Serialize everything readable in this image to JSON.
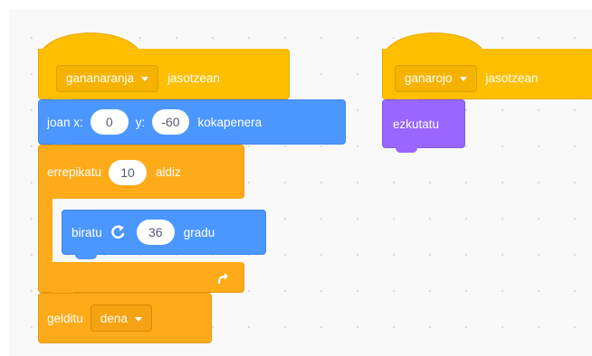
{
  "scripts": [
    {
      "hat": {
        "message": "gananaranja",
        "suffix": "jasotzean"
      },
      "goto": {
        "prefix": "joan x:",
        "x": "0",
        "y_label": "y:",
        "y": "-60",
        "suffix": "kokapenera"
      },
      "repeat": {
        "prefix": "errepikatu",
        "times": "10",
        "suffix": "aldiz"
      },
      "turn": {
        "prefix": "biratu",
        "degrees": "36",
        "suffix": "gradu"
      },
      "stop": {
        "prefix": "gelditu",
        "option": "dena"
      }
    },
    {
      "hat": {
        "message": "ganarojo",
        "suffix": "jasotzean"
      },
      "hide": {
        "label": "ezkutatu"
      }
    }
  ],
  "colors": {
    "events": "#ffbf00",
    "motion": "#4c97ff",
    "control": "#ffab19",
    "looks": "#9966ff",
    "workspace": "#f9f9f9"
  },
  "icons": {
    "turn": "rotate-right-icon",
    "repeat_end": "loop-arrow-icon",
    "dropdown": "caret-down-icon"
  }
}
